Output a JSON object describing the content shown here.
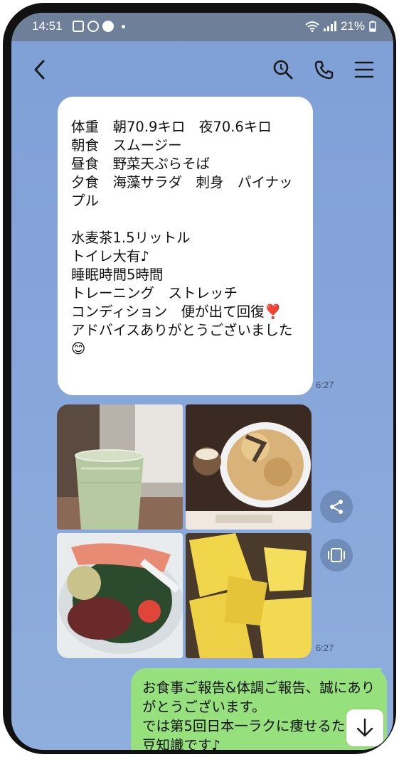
{
  "status_bar": {
    "time": "14:51",
    "notification_icons": [
      "gallery-icon",
      "instagram-icon",
      "check-circle-icon"
    ],
    "battery": "21%",
    "icons": [
      "wifi-icon",
      "signal-icon",
      "battery-charging-icon"
    ]
  },
  "header": {
    "back_icon": "chevron-left-icon",
    "actions": [
      "search-icon",
      "phone-icon",
      "menu-icon"
    ]
  },
  "messages": [
    {
      "direction": "incoming",
      "text": "体重　朝70.9キロ　夜70.6キロ\n朝食　スムージー\n昼食　野菜天ぷらそば\n夕食　海藻サラダ　刺身　パイナップル\n\n水麦茶1.5リットル\nトイレ大有♪\n睡眠時間5時間\nトレーニング　ストレッチ\nコンディション　便が出て回復❣️\nアドバイスありがとうございました😊",
      "time": "6:27"
    },
    {
      "direction": "incoming",
      "type": "photo-grid",
      "photos": [
        "smoothie-glass",
        "tempura-soba",
        "seaweed-salad-sashimi",
        "pineapple"
      ],
      "time": "6:27"
    },
    {
      "direction": "outgoing",
      "text": "お食事ご報告&体調ご報告、誠にありがとうございます。\nでは第5回日本一ラクに痩せるための豆知識です♪"
    }
  ],
  "side_actions": [
    "share-icon",
    "screenshot-icon"
  ],
  "scroll_down_icon": "arrow-down-icon",
  "colors": {
    "chat_background": "#86a5da",
    "outgoing_bubble": "#97e07e",
    "incoming_bubble": "#ffffff",
    "status_bar": "#6e7f9a"
  }
}
